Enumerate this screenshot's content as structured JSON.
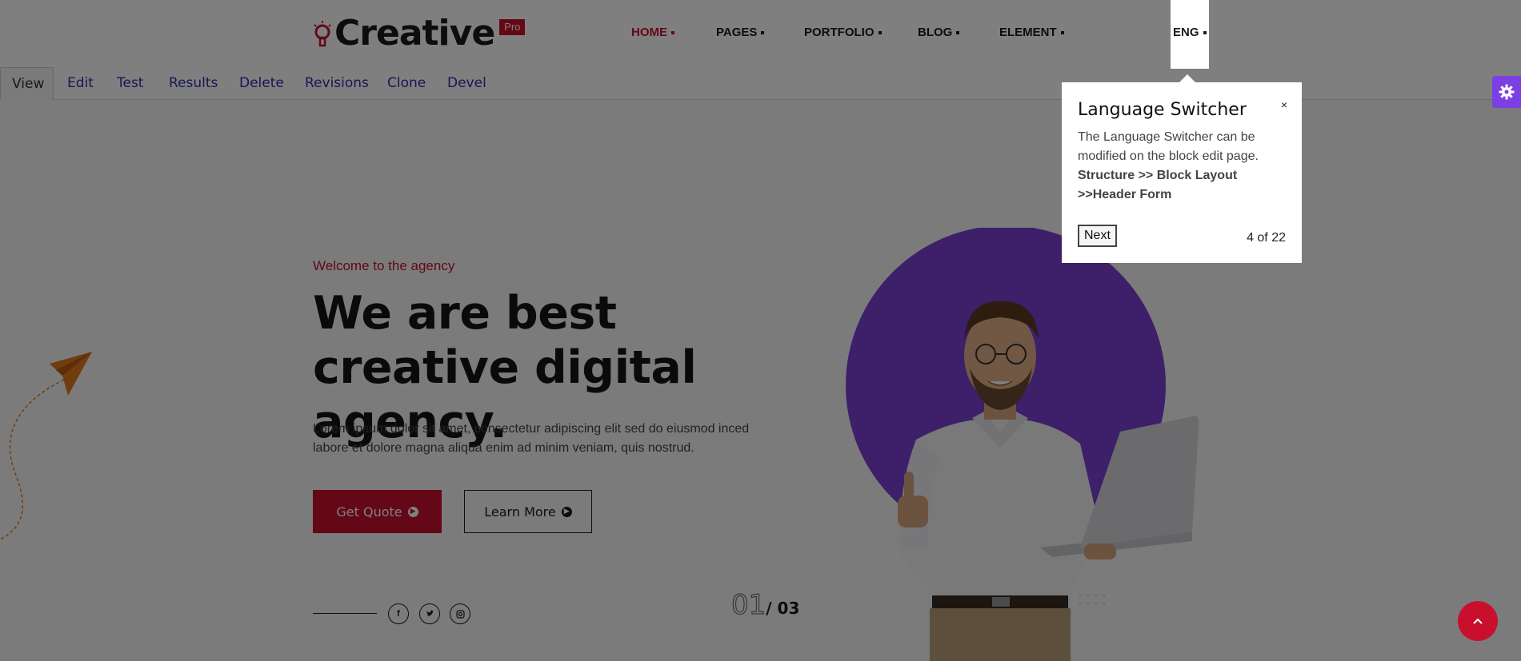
{
  "brand": {
    "name": "Creative",
    "badge": "Pro"
  },
  "nav": {
    "items": [
      {
        "label": "HOME",
        "active": true
      },
      {
        "label": "PAGES"
      },
      {
        "label": "PORTFOLIO"
      },
      {
        "label": "BLOG"
      },
      {
        "label": "ELEMENT"
      }
    ],
    "language": "ENG"
  },
  "admin_tabs": [
    "View",
    "Edit",
    "Test",
    "Results",
    "Delete",
    "Revisions",
    "Clone",
    "Devel"
  ],
  "hero": {
    "welcome": "Welcome to the agency",
    "headline": "We are best creative digital agency.",
    "description": "Lorem ipsum dolor sit amet, consectetur adipiscing elit sed do eiusmod inced labore et dolore magna aliqua enim ad minim veniam, quis nostrud.",
    "quote_button": "Get Quote",
    "more_button": "Learn More",
    "slide_current": "01",
    "slide_total": "/ 03",
    "social_icons": [
      "facebook-icon",
      "twitter-icon",
      "instagram-icon"
    ]
  },
  "tour": {
    "title": "Language Switcher",
    "close": "×",
    "body": "The Language Switcher can be modified on the block edit page.",
    "path": "Structure >> Block Layout >>Header Form",
    "next": "Next",
    "progress": "4 of 22"
  },
  "colors": {
    "brand_red": "#c8102e",
    "accent_purple": "#7b3fe4",
    "circle_purple": "#7a3fd4"
  }
}
